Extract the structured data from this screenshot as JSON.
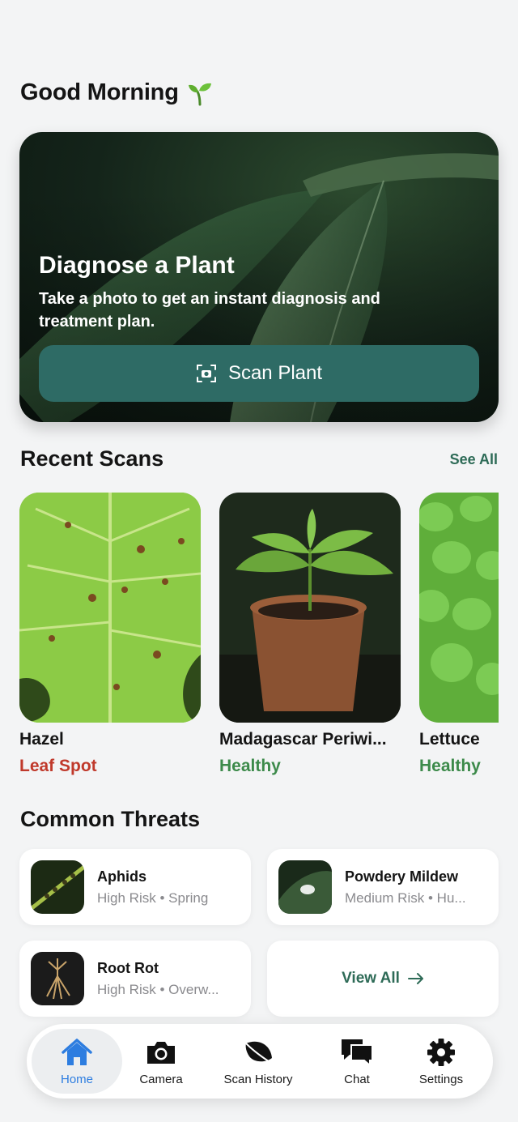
{
  "header": {
    "greeting": "Good Morning",
    "greeting_icon": "seedling-icon"
  },
  "hero": {
    "title": "Diagnose a Plant",
    "subtitle": "Take a photo to get an instant diagnosis and treatment plan.",
    "button_label": "Scan Plant",
    "button_color": "#2e6b65"
  },
  "recent": {
    "title": "Recent Scans",
    "see_all": "See All",
    "items": [
      {
        "name": "Hazel",
        "status": "Leaf Spot",
        "status_color": "#c0392b"
      },
      {
        "name": "Madagascar Periwi...",
        "status": "Healthy",
        "status_color": "#3c8a4a"
      },
      {
        "name": "Lettuce",
        "status": "Healthy",
        "status_color": "#3c8a4a"
      }
    ]
  },
  "threats": {
    "title": "Common Threats",
    "items": [
      {
        "name": "Aphids",
        "risk": "High Risk",
        "season": "Spring"
      },
      {
        "name": "Powdery Mildew",
        "risk": "Medium Risk",
        "season": "Hu..."
      },
      {
        "name": "Root Rot",
        "risk": "High Risk",
        "season": "Overw..."
      }
    ],
    "view_all": "View All",
    "separator": "•"
  },
  "tabs": [
    {
      "label": "Home",
      "icon": "home-icon",
      "active": true
    },
    {
      "label": "Camera",
      "icon": "camera-icon"
    },
    {
      "label": "Scan History",
      "icon": "leaf-icon"
    },
    {
      "label": "Chat",
      "icon": "chat-icon"
    },
    {
      "label": "Settings",
      "icon": "gear-icon"
    }
  ],
  "colors": {
    "accent": "#2e6b57",
    "active_tab": "#2d7de0"
  }
}
